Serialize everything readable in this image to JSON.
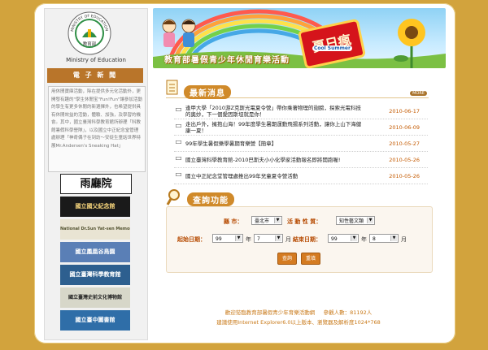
{
  "ministry": {
    "name_en": "Ministry of Education",
    "logo_ring_text": "MINISTRY OF EDUCATION",
    "logo_center_text": "教育部"
  },
  "sidebar": {
    "news_header": "電 子 新 聞",
    "news_excerpt": "用休閒寶庫活動，除在提供多元化活動外，更開發有趣的\"學生休閒宝\"Fun!Fun\"讓參加活動的學生有更多休閒的新選擇外，也希望提供具有休閒效益的活動，體驗、加強，及學習的機會。其中，國立臺灣科學教育館所辦理「科教館暑假科學營隊」，以及國立中正紀念堂管理處辦理「神奇偶子在到訪～安徒生童話世界特展Mr.Andersen's Sneaking Hat」",
    "link_banners": [
      "雨廳院",
      "國立國父紀念館",
      "National Dr.Sun Yat-sen Memorial Hall",
      "國立鳳凰谷鳥園",
      "國立臺灣科學教育館",
      "國立臺灣史前文化博物館",
      "國立臺中圖書館"
    ]
  },
  "header": {
    "banner_title": "教育部暑假青少年休閒育樂活動",
    "summer_sign": "夏日瘋",
    "cool_tag": "Cool Summer"
  },
  "news": {
    "title": "最新消息",
    "more_label": "MORE",
    "items": [
      {
        "text": "逢甲大學「2010游Z克斯光電夏令營」帶你乘著物理的翅膀，探索光電科技的奧妙，下一個愛因斯坦就是你！",
        "date": "2010-06-17"
      },
      {
        "text": "走出戶外，擁抱山海！99年度學生暑期運動飛揚系列活動，讓你上山下海健康一夏！",
        "date": "2010-06-09"
      },
      {
        "text": "99年學生暑假樂學暑期育樂營【簡章】",
        "date": "2010-05-27"
      },
      {
        "text": "國立臺灣科學教育館-2010巴斯夫小小化學家活動報名即將開跑喔!",
        "date": "2010-05-26"
      },
      {
        "text": "國立中正紀念堂管理處推出99年兒童夏令營活動",
        "date": "2010-05-26"
      }
    ]
  },
  "query": {
    "title": "查詢功能",
    "county_label": "縣  市：",
    "county_value": "臺北市",
    "category_label": "活 動 性 質：",
    "category_value": "知性藝文類",
    "start_label": "起始日期：",
    "end_label": "結束日期：",
    "year_unit": "年",
    "month_unit": "月",
    "start_year": "99",
    "start_month": "7",
    "end_year": "99",
    "end_month": "8",
    "search_btn": "查詢",
    "reset_btn": "重填"
  },
  "footer": {
    "welcome": "歡迎蒞臨教育部暑假青少年育樂活動網",
    "visitors_label": "參觀人數：",
    "visitors": "81192人",
    "browser_note": "建議使用Internet Explorer6.0以上版本、瀏覽器及解析度1024*768"
  }
}
